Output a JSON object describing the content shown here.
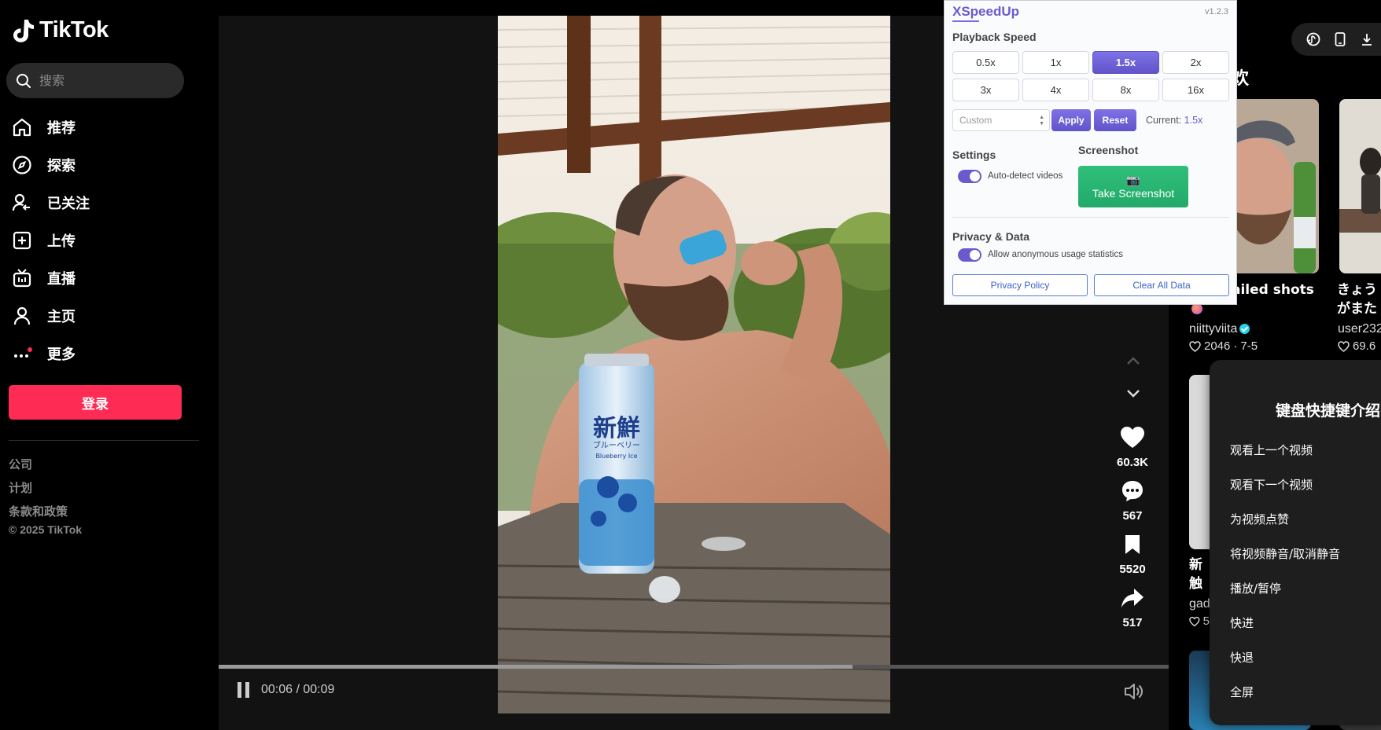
{
  "sidebar": {
    "logo_text": "TikTok",
    "search_placeholder": "搜索",
    "nav": [
      {
        "label": "推荐",
        "icon": "home-icon"
      },
      {
        "label": "探索",
        "icon": "compass-icon"
      },
      {
        "label": "已关注",
        "icon": "following-icon"
      },
      {
        "label": "上传",
        "icon": "upload-icon"
      },
      {
        "label": "直播",
        "icon": "live-icon"
      },
      {
        "label": "主页",
        "icon": "profile-icon"
      },
      {
        "label": "更多",
        "icon": "more-icon"
      }
    ],
    "login_label": "登录",
    "footer_links": [
      "公司",
      "计划",
      "条款和政策"
    ],
    "copyright": "© 2025 TikTok"
  },
  "video": {
    "time": "00:06 / 00:09",
    "progress": 0.667,
    "likes": "60.3K",
    "comments": "567",
    "saves": "5520",
    "shares": "517",
    "can_text_1": "新鮮",
    "can_text_2": "ブルーベリー",
    "can_text_3": "Blueberry Ice"
  },
  "right": {
    "section_title": "欢",
    "cards": [
      {
        "title": "ailed shots",
        "user": "niittyviita",
        "likes": "2046",
        "date": "7-5"
      },
      {
        "title_1": "きょう",
        "title_2": "がまた",
        "user": "user232",
        "likes": "69.6"
      },
      {
        "title_1": "新",
        "title_2": "触",
        "user": "gad",
        "likes": "5"
      }
    ]
  },
  "shortcuts": {
    "title": "键盘快捷键介绍",
    "items": [
      "观看上一个视频",
      "观看下一个视频",
      "为视频点赞",
      "将视频静音/取消静音",
      "播放/暂停",
      "快进",
      "快退",
      "全屏"
    ]
  },
  "extension": {
    "title": "XSpeedUp",
    "version": "v1.2.3",
    "playback_label": "Playback Speed",
    "speeds": [
      "0.5x",
      "1x",
      "1.5x",
      "2x",
      "3x",
      "4x",
      "8x",
      "16x"
    ],
    "active_speed": "1.5x",
    "custom_placeholder": "Custom",
    "apply_label": "Apply",
    "reset_label": "Reset",
    "current_label": "Current:",
    "current_value": "1.5x",
    "settings_label": "Settings",
    "auto_detect_label": "Auto-detect videos",
    "screenshot_label": "Screenshot",
    "screenshot_button_icon": "📷",
    "screenshot_button": "Take Screenshot",
    "privacy_label": "Privacy & Data",
    "anon_label": "Allow anonymous usage statistics",
    "privacy_policy_label": "Privacy Policy",
    "clear_data_label": "Clear All Data",
    "accent_color": "#6a5acd",
    "screenshot_color": "#22a96a"
  }
}
